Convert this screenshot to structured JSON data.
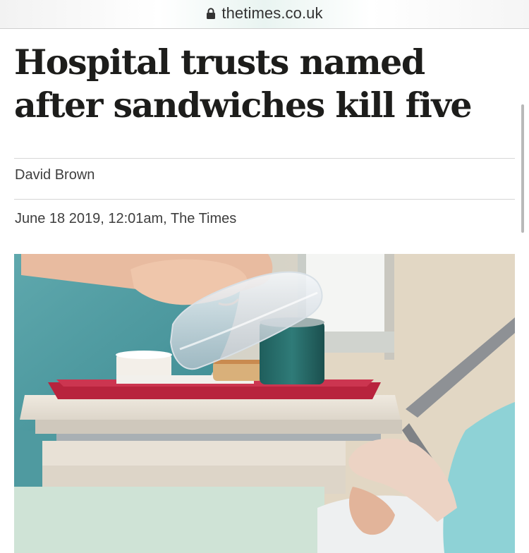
{
  "browser": {
    "url": "thetimes.co.uk",
    "lock_icon": "lock-icon"
  },
  "article": {
    "headline": "Hospital trusts named after sandwiches kill five",
    "author": "David Brown",
    "dateline": "June 18 2019, 12:01am, The Times"
  },
  "image": {
    "subject": "hospital-meal-tray-photo"
  }
}
